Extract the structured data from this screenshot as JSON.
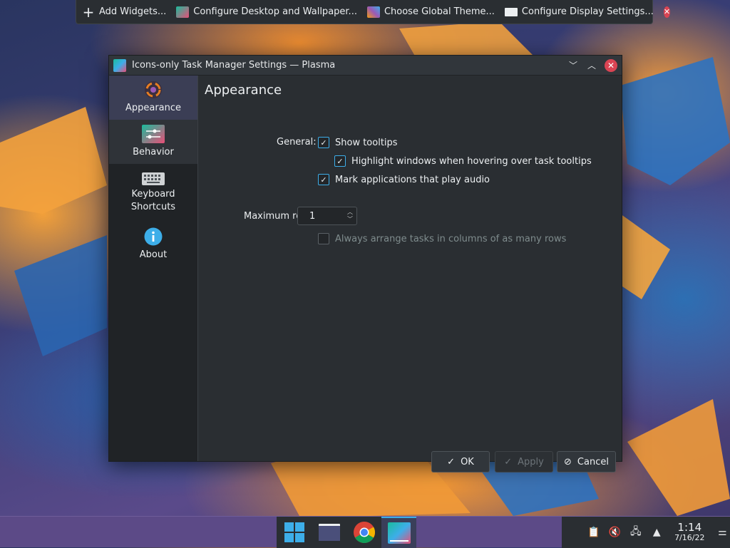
{
  "topbar": {
    "items": [
      {
        "label": "Add Widgets...",
        "icon": "plus-icon"
      },
      {
        "label": "Configure Desktop and Wallpaper...",
        "icon": "desktop-icon"
      },
      {
        "label": "Choose Global Theme...",
        "icon": "theme-icon"
      },
      {
        "label": "Configure Display Settings...",
        "icon": "display-icon"
      }
    ],
    "close_icon": "close-icon"
  },
  "window": {
    "title": "Icons-only Task Manager Settings — Plasma",
    "sidebar": [
      {
        "label": "Appearance",
        "icon": "appearance-icon",
        "active": true
      },
      {
        "label": "Behavior",
        "icon": "behavior-icon"
      },
      {
        "label_line1": "Keyboard",
        "label_line2": "Shortcuts",
        "icon": "keyboard-icon"
      },
      {
        "label": "About",
        "icon": "info-icon"
      }
    ],
    "page_title": "Appearance",
    "general_label": "General:",
    "options": {
      "show_tooltips": {
        "label": "Show tooltips",
        "checked": true
      },
      "highlight_windows": {
        "label": "Highlight windows when hovering over task tooltips",
        "checked": true
      },
      "mark_audio": {
        "label": "Mark applications that play audio",
        "checked": true
      }
    },
    "max_rows_label": "Maximum rows:",
    "max_rows_value": "1",
    "arrange_columns": {
      "label": "Always arrange tasks in columns of as many rows",
      "checked": false,
      "disabled": true
    },
    "buttons": {
      "ok": "OK",
      "apply": "Apply",
      "cancel": "Cancel"
    }
  },
  "taskbar": {
    "apps": [
      "start-menu-icon",
      "file-manager-icon",
      "chrome-icon",
      "system-settings-icon"
    ],
    "clock_time": "1:14",
    "clock_date": "7/16/22"
  },
  "colors": {
    "accent": "#3daee9",
    "close": "#da4453",
    "panel": "#5c4a87"
  }
}
